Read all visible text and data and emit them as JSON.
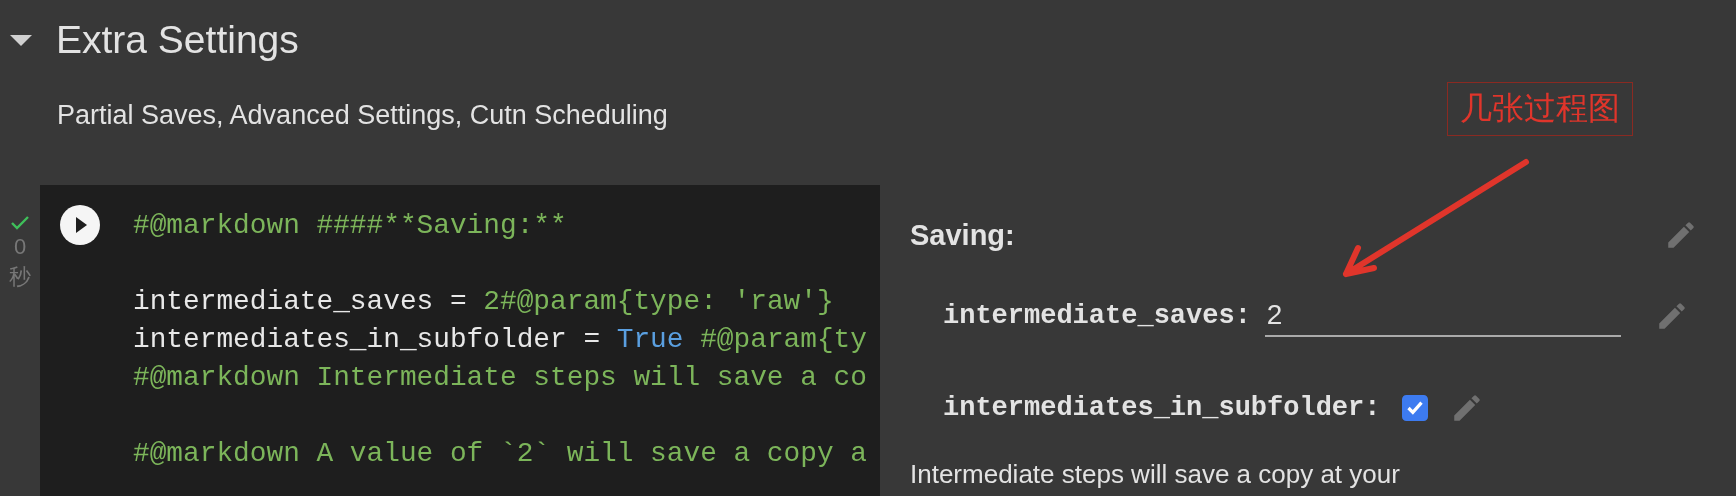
{
  "section": {
    "title": "Extra Settings",
    "expanded": true,
    "description": "Partial Saves, Advanced Settings, Cutn Scheduling"
  },
  "cell": {
    "succeeded": true,
    "duration": "0",
    "duration_unit": "秒",
    "code_blocks": [
      {
        "lines": [
          [
            {
              "kind": "comment",
              "text": "#@markdown ####**Saving:**"
            }
          ]
        ]
      },
      {
        "lines": [
          [
            {
              "kind": "plain",
              "text": "intermediate_saves = "
            },
            {
              "kind": "comment",
              "text": "2#@param{type: 'raw'}"
            }
          ],
          [
            {
              "kind": "plain",
              "text": "intermediates_in_subfolder = "
            },
            {
              "kind": "keyword",
              "text": "True"
            },
            {
              "kind": "comment",
              "text": " #@param{ty"
            }
          ],
          [
            {
              "kind": "comment",
              "text": "#@markdown Intermediate steps will save a co"
            }
          ]
        ]
      },
      {
        "lines": [
          [
            {
              "kind": "comment",
              "text": "#@markdown A value of `2` will save a copy a"
            }
          ]
        ]
      }
    ],
    "form": {
      "heading": "Saving:",
      "fields": [
        {
          "kind": "text",
          "label": "intermediate_saves:",
          "value": "2"
        },
        {
          "kind": "checkbox",
          "label": "intermediates_in_subfolder:",
          "checked": true
        }
      ],
      "note": "Intermediate steps will save a copy at your"
    }
  },
  "annotation": {
    "text": "几张过程图"
  }
}
